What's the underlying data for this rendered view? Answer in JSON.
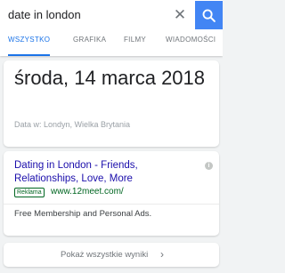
{
  "search": {
    "query": "date in london",
    "clear_glyph": "✕",
    "search_icon": "search-icon"
  },
  "tabs": [
    {
      "label": "WSZYSTKO",
      "active": true
    },
    {
      "label": "GRAFIKA",
      "active": false
    },
    {
      "label": "FILMY",
      "active": false
    },
    {
      "label": "WIADOMOŚCI",
      "active": false
    }
  ],
  "date_card": {
    "date": "środa, 14 marca 2018",
    "source": "Data w: Londyn, Wielka Brytania"
  },
  "ad_card": {
    "title": "Dating in London - Friends, Relationships, Love, More",
    "badge": "Reklama",
    "url": "www.12meet.com/",
    "description": "Free Membership and Personal Ads.",
    "info_glyph": "i"
  },
  "more_results": {
    "label": "Pokaż wszystkie wyniki",
    "chevron": "›"
  },
  "colors": {
    "accent": "#4285f4",
    "tab_active": "#1a73e8",
    "link": "#1a0dab",
    "url_green": "#006621",
    "background": "#f1f3f4"
  }
}
